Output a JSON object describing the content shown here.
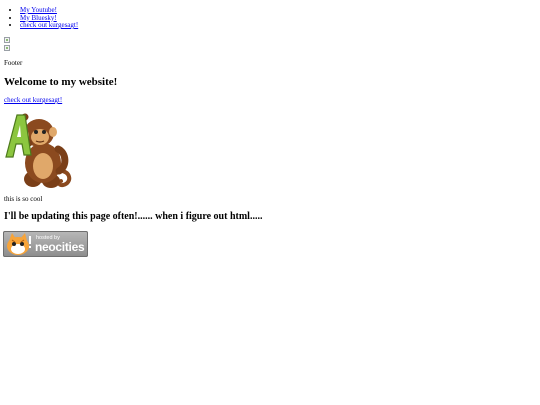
{
  "nav": {
    "items": [
      {
        "label": "My Youtube!"
      },
      {
        "label": "My Bluesky!"
      },
      {
        "label": "check out kurgesagt!"
      }
    ]
  },
  "footer_text": "Footer",
  "heading": "Welcome to my website!",
  "kurzgesagt_link": "check out kurgesagt!",
  "caption": "this is so cool",
  "subheading": "I'll be updating this page often!...... when i figure out html.....",
  "neocities_badge": {
    "hosted_text": "hosted by",
    "brand_text": "neocities"
  },
  "colors": {
    "link": "#0000ee",
    "monkey_brown": "#8b4a1f",
    "monkey_green": "#8cc63f",
    "badge_gray": "#9a9a9a"
  }
}
